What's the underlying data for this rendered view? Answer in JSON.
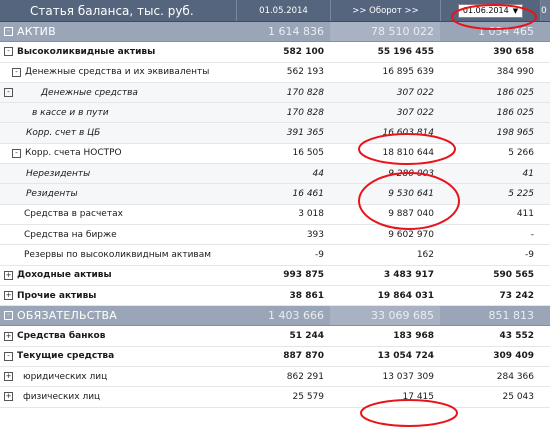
{
  "header": {
    "title": "Статья баланса, тыс. руб.",
    "col1": "01.05.2014",
    "col2": ">> Оборот >>",
    "col3_select": "01.06.2014",
    "col3_arrow": "▼",
    "col4": "0"
  },
  "rows": [
    {
      "label": "АКТИВ",
      "v1": "1 614 836",
      "v2": "78 510 022",
      "v3": "1 054 465",
      "toggle": "-"
    },
    {
      "label": "Высоколиквидные активы",
      "v1": "582 100",
      "v2": "55 196 455",
      "v3": "390 658",
      "toggle": "-"
    },
    {
      "label": "Денежные средства и их эквиваленты",
      "v1": "562 193",
      "v2": "16 895 639",
      "v3": "384 990",
      "toggle": "-"
    },
    {
      "label": "Денежные средства",
      "v1": "170 828",
      "v2": "307 022",
      "v3": "186 025",
      "toggle": "-"
    },
    {
      "label": "в кассе и в пути",
      "v1": "170 828",
      "v2": "307 022",
      "v3": "186 025"
    },
    {
      "label": "Корр. счет в ЦБ",
      "v1": "391 365",
      "v2": "16 603 814",
      "v3": "198 965"
    },
    {
      "label": "Корр. счета НОСТРО",
      "v1": "16 505",
      "v2": "18 810 644",
      "v3": "5 266",
      "toggle": "-"
    },
    {
      "label": "Нерезиденты",
      "v1": "44",
      "v2": "9 280 003",
      "v3": "41"
    },
    {
      "label": "Резиденты",
      "v1": "16 461",
      "v2": "9 530 641",
      "v3": "5 225"
    },
    {
      "label": "Средства в расчетах",
      "v1": "3 018",
      "v2": "9 887 040",
      "v3": "411"
    },
    {
      "label": "Средства на бирже",
      "v1": "393",
      "v2": "9 602 970",
      "v3": "-"
    },
    {
      "label": "Резервы по высоколиквидным активам",
      "v1": "-9",
      "v2": "162",
      "v3": "-9"
    },
    {
      "label": "Доходные активы",
      "v1": "993 875",
      "v2": "3 483 917",
      "v3": "590 565",
      "toggle": "+"
    },
    {
      "label": "Прочие активы",
      "v1": "38 861",
      "v2": "19 864 031",
      "v3": "73 242",
      "toggle": "+"
    },
    {
      "label": "ОБЯЗАТЕЛЬСТВА",
      "v1": "1 403 666",
      "v2": "33 069 685",
      "v3": "851 813",
      "toggle": "-"
    },
    {
      "label": "Средства банков",
      "v1": "51 244",
      "v2": "183 968",
      "v3": "43 552",
      "toggle": "+"
    },
    {
      "label": "Текущие средства",
      "v1": "887 870",
      "v2": "13 054 724",
      "v3": "309 409",
      "toggle": "-"
    },
    {
      "label": "юридических лиц",
      "v1": "862 291",
      "v2": "13 037 309",
      "v3": "284 366",
      "toggle": "+"
    },
    {
      "label": "физических лиц",
      "v1": "25 579",
      "v2": "17 415",
      "v3": "25 043",
      "toggle": "+"
    }
  ],
  "annotation_color": "#e8141c"
}
